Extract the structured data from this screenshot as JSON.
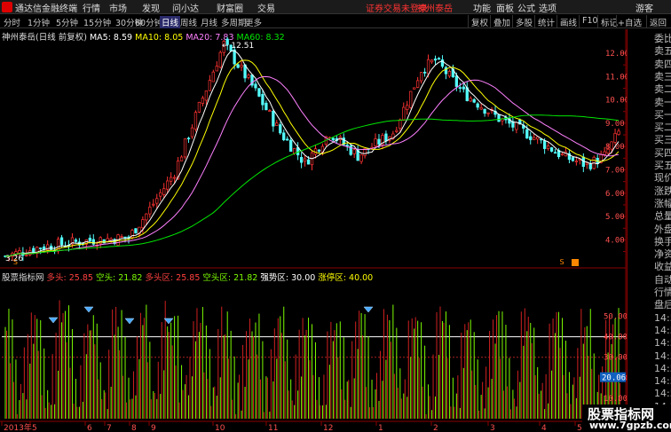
{
  "titlebar": {
    "app": "通达信金融终端",
    "menus": [
      "行情",
      "市场",
      "发现",
      "问小达",
      "财富圈",
      "交易"
    ],
    "notice": "证券交易未登录",
    "notice_stock": "神州泰岳",
    "right_menus": [
      "功能",
      "面板",
      "公式",
      "选项"
    ],
    "guest": "游客"
  },
  "toolbar": {
    "periods": [
      "分时",
      "1分钟",
      "5分钟",
      "15分钟",
      "30分钟",
      "60分钟",
      "日线",
      "周线",
      "月线",
      "多周期",
      "更多"
    ],
    "selected": "日线",
    "buttons": [
      "复权",
      "叠加",
      "多股",
      "统计",
      "画线",
      "F10",
      "标记",
      "+自选",
      "返回"
    ]
  },
  "main_info": {
    "stock": "神州泰岳(日线 前复权)",
    "ma5": "MA5: 8.59",
    "ma10": "MA10: 8.05",
    "ma20": "MA20: 7.83",
    "ma60": "MA60: 8.32"
  },
  "price_axis": [
    "12.00",
    "11.00",
    "10.00",
    "9.00",
    "8.00",
    "7.00",
    "6.00",
    "5.00",
    "4.00"
  ],
  "high_label": "12.51",
  "low_label": "3.26",
  "sub_info": {
    "name": "股票指标网",
    "duotou": "多头: 25.85",
    "kongtou": "空头: 21.82",
    "duotouqu": "多头区: 25.85",
    "kongtouqu": "空头区: 21.82",
    "qiangshi": "强势区: 30.00",
    "zhangting": "涨停区: 40.00"
  },
  "sub_axis": [
    "50.00",
    "40.00",
    "30.00",
    "20.00",
    "10.00",
    "0.00"
  ],
  "sub_value": "20.06",
  "dates": [
    "2013年",
    "5",
    "6",
    "7",
    "8",
    "9",
    "10",
    "11",
    "12",
    "1",
    "2",
    "3",
    "4",
    "5"
  ],
  "right_panel": [
    "委比",
    "卖五",
    "卖四",
    "卖三",
    "卖二",
    "卖一",
    "买一",
    "买二",
    "买三",
    "买四",
    "买五",
    "现价",
    "涨跌",
    "涨幅",
    "总量",
    "外盘",
    "换手",
    "净资",
    "收益",
    "自动",
    "行情",
    "盘后",
    "14:50",
    "14:50",
    "14:50",
    "14:50",
    "14:50",
    "14:50",
    "14:50",
    "14:50"
  ],
  "watermark": {
    "title": "股票指标网",
    "url": "www.7gpzb.com"
  },
  "colors": {
    "up": "#ff3232",
    "down": "#54fcfc",
    "ma5": "#ffffff",
    "ma10": "#ffff00",
    "ma20": "#ff80ff",
    "ma60": "#00e600",
    "sub_red": "#d02020",
    "sub_green": "#7cfc00"
  }
}
